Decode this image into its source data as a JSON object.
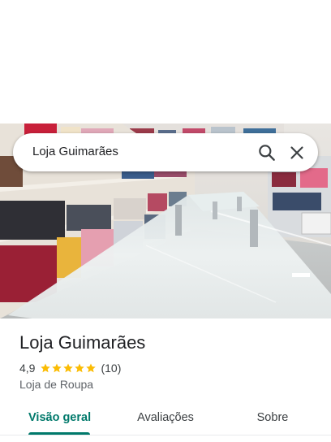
{
  "search": {
    "query": "Loja Guimarães"
  },
  "icons": {
    "search": "search-icon",
    "close": "close-icon",
    "star": "star-icon"
  },
  "photo": {
    "subject": "clothing store interior with glass counter"
  },
  "place": {
    "name": "Loja Guimarães",
    "rating": "4,9",
    "rating_value": 4.9,
    "stars": 5,
    "review_count": "(10)",
    "category": "Loja de Roupa"
  },
  "tabs": [
    {
      "label": "Visão geral",
      "active": true
    },
    {
      "label": "Avaliações",
      "active": false
    },
    {
      "label": "Sobre",
      "active": false
    }
  ],
  "colors": {
    "accent": "#00796b",
    "star": "#fbbc04",
    "text": "#202124",
    "secondary_text": "#5f6368"
  }
}
